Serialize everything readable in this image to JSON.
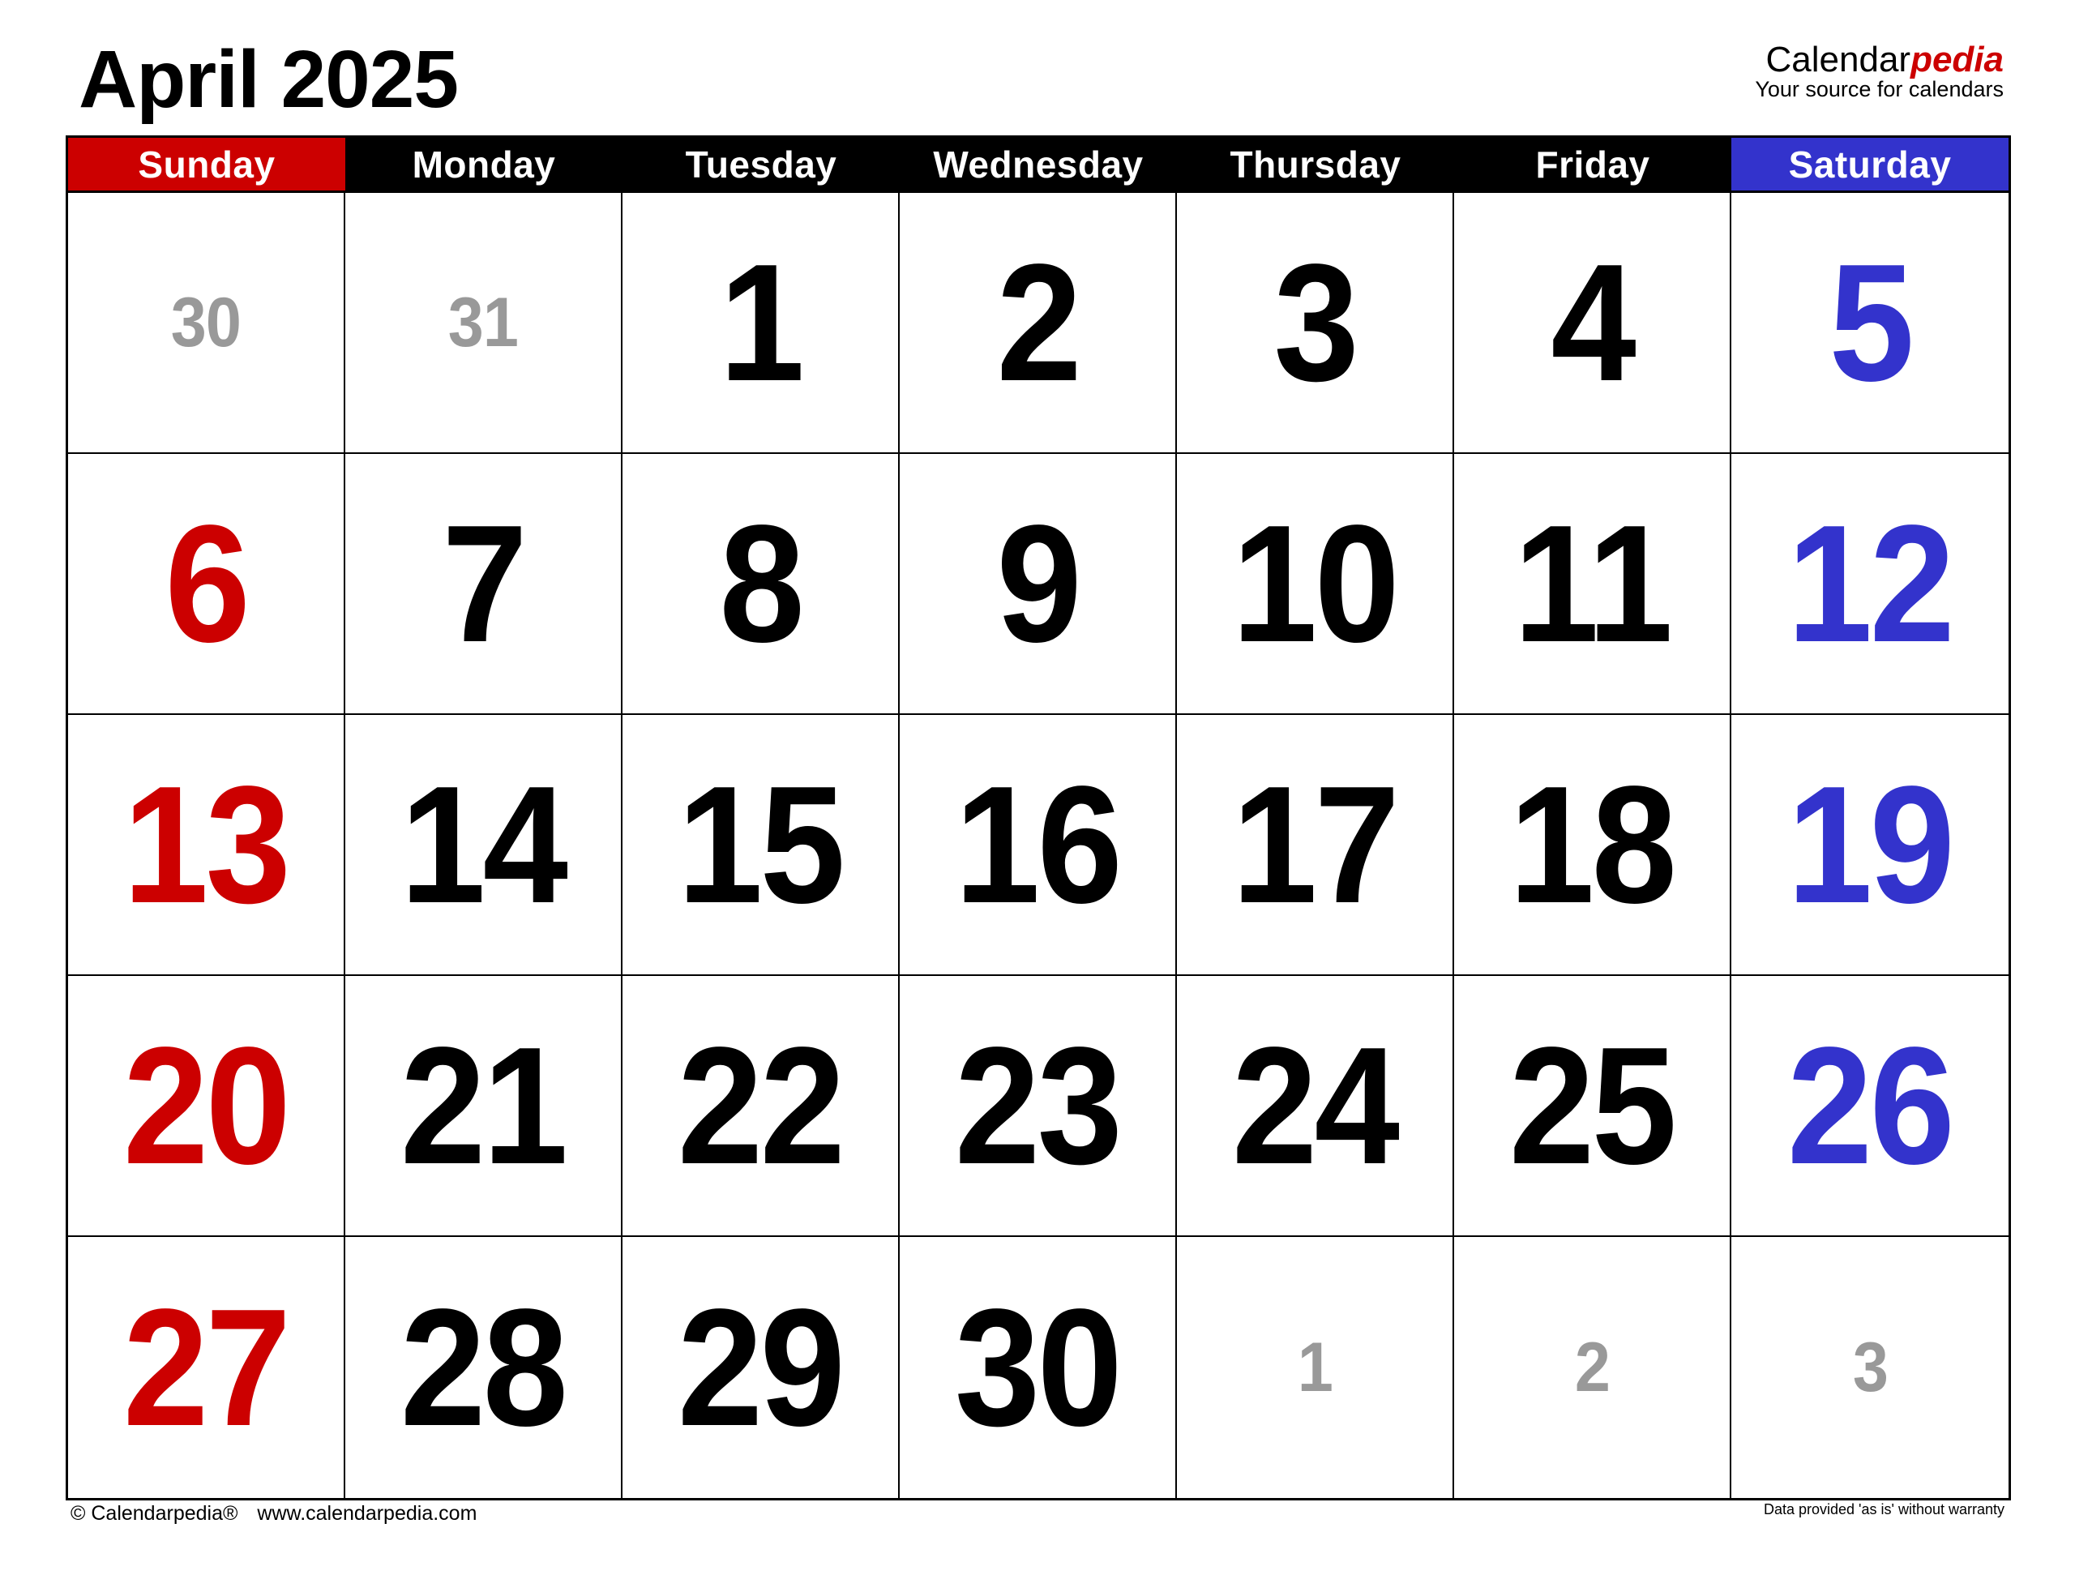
{
  "title": "April 2025",
  "logo": {
    "name_plain": "Calendar",
    "name_accent": "pedia",
    "tagline": "Your source for calendars"
  },
  "colors": {
    "sunday": "#cc0000",
    "saturday": "#3333cc",
    "weekday": "#000000",
    "other_month": "#999999"
  },
  "weekdays": [
    "Sunday",
    "Monday",
    "Tuesday",
    "Wednesday",
    "Thursday",
    "Friday",
    "Saturday"
  ],
  "weeks": [
    [
      {
        "d": "30",
        "other": true
      },
      {
        "d": "31",
        "other": true
      },
      {
        "d": "1"
      },
      {
        "d": "2"
      },
      {
        "d": "3"
      },
      {
        "d": "4"
      },
      {
        "d": "5"
      }
    ],
    [
      {
        "d": "6"
      },
      {
        "d": "7"
      },
      {
        "d": "8"
      },
      {
        "d": "9"
      },
      {
        "d": "10"
      },
      {
        "d": "11"
      },
      {
        "d": "12"
      }
    ],
    [
      {
        "d": "13"
      },
      {
        "d": "14"
      },
      {
        "d": "15"
      },
      {
        "d": "16"
      },
      {
        "d": "17"
      },
      {
        "d": "18"
      },
      {
        "d": "19"
      }
    ],
    [
      {
        "d": "20"
      },
      {
        "d": "21"
      },
      {
        "d": "22"
      },
      {
        "d": "23"
      },
      {
        "d": "24"
      },
      {
        "d": "25"
      },
      {
        "d": "26"
      }
    ],
    [
      {
        "d": "27"
      },
      {
        "d": "28"
      },
      {
        "d": "29"
      },
      {
        "d": "30"
      },
      {
        "d": "1",
        "other": true
      },
      {
        "d": "2",
        "other": true
      },
      {
        "d": "3",
        "other": true
      }
    ]
  ],
  "footer": {
    "copyright": "© Calendarpedia®",
    "url": "www.calendarpedia.com",
    "disclaimer": "Data provided 'as is' without warranty"
  }
}
